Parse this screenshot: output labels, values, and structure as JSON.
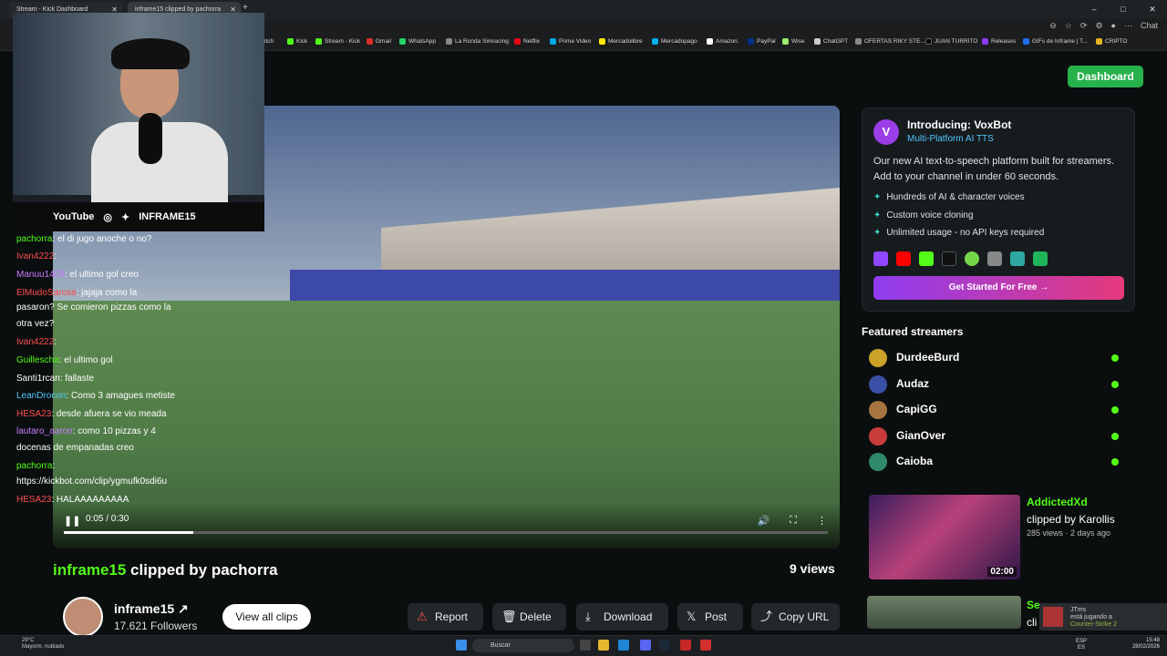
{
  "browser": {
    "tabs": [
      {
        "label": "Stream - Kick Dashboard"
      },
      {
        "label": "inframe15 clipped by pachorra"
      }
    ],
    "new_tab": "+",
    "window_controls": [
      "–",
      "□",
      "✕"
    ],
    "chat_button": "Chat",
    "bookmarks": [
      "itch",
      "Kick",
      "Stream - Kick",
      "Gmail",
      "WhatsApp",
      "La Ronda Simracing",
      "Netflix",
      "Prime Video",
      "Mercadolibre",
      "Mercadopago",
      "Amazon.",
      "PayPal",
      "Wise",
      "ChatGPT",
      "OFERTAS RIKY STE...",
      "JUAN TURRITO",
      "Releases",
      "GIFs de Inframe | T...",
      "CRIPTO"
    ]
  },
  "header": {
    "dashboard_label": "Dashboard"
  },
  "webcam": {
    "youtube": "YouTube",
    "handle": "INFRAME15"
  },
  "chat": [
    {
      "user": "pachorra",
      "text": ": el di jugo anoche o no?",
      "color": "#53fc18"
    },
    {
      "user": "Ivan4222",
      "text": ":",
      "color": "#ff4d4d"
    },
    {
      "user": "Manuu1409",
      "text": ": el ultimo gol creo",
      "color": "#c77dff"
    },
    {
      "user": "ElMudoSarosa",
      "text": ": jajaja como la",
      "color": "#ff4d4d"
    },
    {
      "user": "",
      "text": "pasaron? Se comieron pizzas como la",
      "color": "#fff"
    },
    {
      "user": "",
      "text": "otra vez?",
      "color": "#fff"
    },
    {
      "user": "Ivan4222",
      "text": ":",
      "color": "#ff4d4d"
    },
    {
      "user": "Guillescha",
      "text": ": el ultimo gol",
      "color": "#53fc18"
    },
    {
      "user": "Santi1rcan",
      "text": ": fallaste",
      "color": "#ffffff"
    },
    {
      "user": "LeanDrocon",
      "text": ": Como 3 amagues metiste",
      "color": "#53c7ff"
    },
    {
      "user": "HESA23",
      "text": ": desde afuera se vio meada",
      "color": "#ff4d4d"
    },
    {
      "user": "lautaro_aaron",
      "text": ": como 10 pizzas y 4",
      "color": "#c77dff"
    },
    {
      "user": "",
      "text": "docenas de empanadas creo",
      "color": "#fff"
    },
    {
      "user": "pachorra",
      "text": ":",
      "color": "#53fc18"
    },
    {
      "user": "",
      "text": "https://kickbot.com/clip/ygmufk0sdi6u",
      "color": "#fff"
    },
    {
      "user": "HESA23",
      "text": ": HALAAAAAAAAA",
      "color": "#ff4d4d"
    }
  ],
  "player": {
    "time": "0:05 / 0:30",
    "progress": 0.17
  },
  "clip": {
    "channel": "inframe15",
    "suffix": " clipped by pachorra",
    "views": "9 views"
  },
  "channel": {
    "name": "inframe15",
    "followers": "17.621 Followers",
    "view_all": "View all clips"
  },
  "actions": {
    "report": "Report",
    "delete": "Delete",
    "download": "Download",
    "post": "Post",
    "copy": "Copy URL"
  },
  "promo": {
    "logo": "V",
    "title": "Introducing: VoxBot",
    "subtitle": "Multi-Platform AI TTS",
    "description": "Our new AI text-to-speech platform built for streamers. Add to your channel in under 60 seconds.",
    "features": [
      "Hundreds of AI & character voices",
      "Custom voice cloning",
      "Unlimited usage - no API keys required"
    ],
    "cta": "Get Started For Free →"
  },
  "featured": {
    "title": "Featured streamers",
    "streamers": [
      {
        "name": "DurdeeBurd",
        "color": "#c9a227"
      },
      {
        "name": "Audaz",
        "color": "#3a4fa6"
      },
      {
        "name": "CapiGG",
        "color": "#a5743f"
      },
      {
        "name": "GianOver",
        "color": "#c93c3c"
      },
      {
        "name": "Caioba",
        "color": "#2f8a6b"
      }
    ]
  },
  "clips": [
    {
      "channel": "AddictedXd",
      "by": "clipped by Karollis",
      "meta": "285 views · 2 days ago",
      "duration": "02:00"
    },
    {
      "channel": "Se",
      "by": "cli",
      "meta": "",
      "duration": ""
    }
  ],
  "toast": {
    "title": "JTms",
    "line1": "está jugando a",
    "line2": "Counter-Strike 2"
  },
  "taskbar": {
    "weather_temp": "29°C",
    "weather_desc": "Mayorm. nublado",
    "search": "Buscar",
    "lang1": "ESP",
    "lang2": "ES",
    "time": "15:48",
    "date": "28/02/2026"
  },
  "colors": {
    "kick_green": "#53fc18",
    "accent_purple": "#8e3cf1"
  }
}
